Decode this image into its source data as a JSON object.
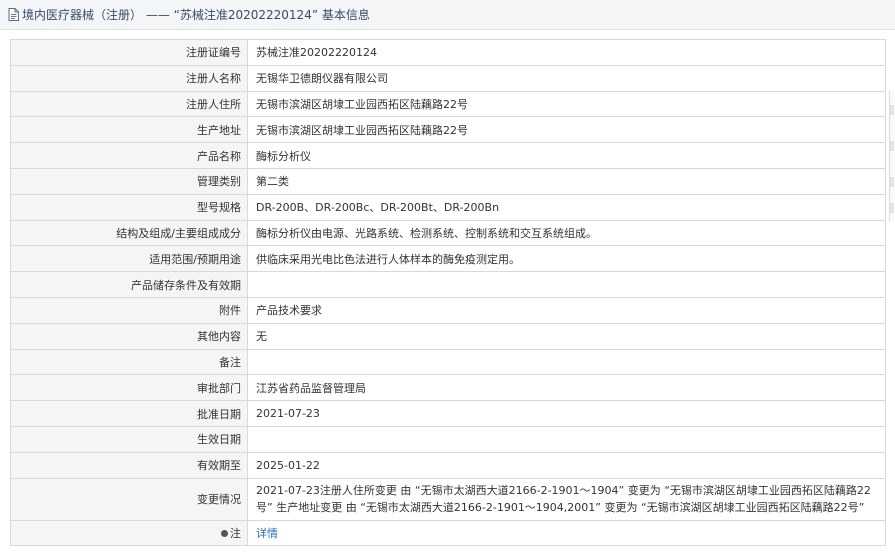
{
  "header": {
    "icon": "document-icon",
    "title": "境内医疗器械（注册） —— “苏械注准20202220124” 基本信息"
  },
  "rows": [
    {
      "label": "注册证编号",
      "value": "苏械注准20202220124"
    },
    {
      "label": "注册人名称",
      "value": "无锡华卫德朗仪器有限公司"
    },
    {
      "label": "注册人住所",
      "value": "无锡市滨湖区胡埭工业园西拓区陆藕路22号"
    },
    {
      "label": "生产地址",
      "value": "无锡市滨湖区胡埭工业园西拓区陆藕路22号"
    },
    {
      "label": "产品名称",
      "value": "酶标分析仪"
    },
    {
      "label": "管理类别",
      "value": "第二类"
    },
    {
      "label": "型号规格",
      "value": "DR-200B、DR-200Bc、DR-200Bt、DR-200Bn"
    },
    {
      "label": "结构及组成/主要组成成分",
      "value": "酶标分析仪由电源、光路系统、检测系统、控制系统和交互系统组成。"
    },
    {
      "label": "适用范围/预期用途",
      "value": "供临床采用光电比色法进行人体样本的酶免疫测定用。"
    },
    {
      "label": "产品储存条件及有效期",
      "value": ""
    },
    {
      "label": "附件",
      "value": "产品技术要求"
    },
    {
      "label": "其他内容",
      "value": "无"
    },
    {
      "label": "备注",
      "value": ""
    },
    {
      "label": "审批部门",
      "value": "江苏省药品监督管理局"
    },
    {
      "label": "批准日期",
      "value": "2021-07-23"
    },
    {
      "label": "生效日期",
      "value": ""
    },
    {
      "label": "有效期至",
      "value": "2025-01-22"
    },
    {
      "label": "变更情况",
      "value": "2021-07-23注册人住所变更 由 “无锡市太湖西大道2166-2-1901～1904” 变更为 “无锡市滨湖区胡埭工业园西拓区陆藕路22号” 生产地址变更 由 “无锡市太湖西大道2166-2-1901～1904,2001” 变更为 “无锡市滨湖区胡埭工业园西拓区陆藕路22号”"
    }
  ],
  "note_row": {
    "label": "注",
    "link": "详情"
  }
}
